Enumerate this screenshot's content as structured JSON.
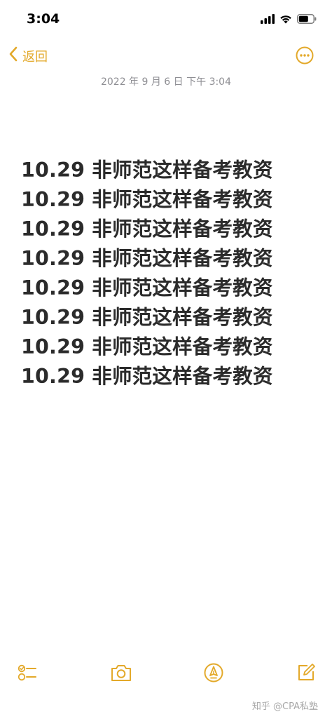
{
  "status_bar": {
    "time": "3:04"
  },
  "nav": {
    "back_label": "返回"
  },
  "note": {
    "date": "2022 年 9 月 6 日  下午 3:04",
    "lines": [
      "10.29 非师范这样备考教资",
      "10.29 非师范这样备考教资",
      "10.29 非师范这样备考教资",
      "10.29 非师范这样备考教资",
      "10.29 非师范这样备考教资",
      "10.29 非师范这样备考教资",
      "10.29 非师范这样备考教资",
      "10.29 非师范这样备考教资"
    ]
  },
  "toolbar": {
    "items": [
      "checklist-icon",
      "camera-icon",
      "markup-icon",
      "compose-icon"
    ]
  },
  "watermark": "知乎 @CPA私塾",
  "colors": {
    "accent": "#e3a92a",
    "date_text": "#8e8e93",
    "body_text": "#2b2b2b"
  }
}
